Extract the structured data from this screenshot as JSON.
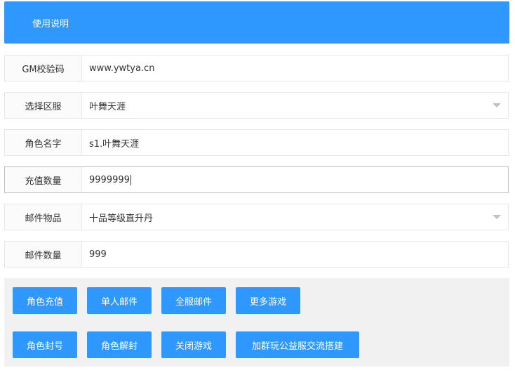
{
  "header": {
    "title": "使用说明"
  },
  "form": {
    "gm_code": {
      "label": "GM校验码",
      "value": "www.ywtya.cn"
    },
    "server": {
      "label": "选择区服",
      "value": "叶舞天涯"
    },
    "role_name": {
      "label": "角色名字",
      "value": "s1.叶舞天涯"
    },
    "recharge_amount": {
      "label": "充值数量",
      "value": "9999999"
    },
    "mail_item": {
      "label": "邮件物品",
      "value": "十品等级直升丹"
    },
    "mail_quantity": {
      "label": "邮件数量",
      "value": "999"
    }
  },
  "buttons": {
    "role_recharge": "角色充值",
    "single_mail": "单人邮件",
    "all_server_mail": "全服邮件",
    "more_games": "更多游戏",
    "ban_role": "角色封号",
    "unban_role": "角色解封",
    "close_game": "关闭游戏",
    "join_group": "加群玩公益服交流搭建"
  },
  "colors": {
    "accent": "#2f98ff",
    "label_bg": "#fbfbfb",
    "border": "#e6e6e6",
    "panel_bg": "#f1f1f1"
  },
  "icons": {
    "dropdown": "chevron-down-icon"
  }
}
